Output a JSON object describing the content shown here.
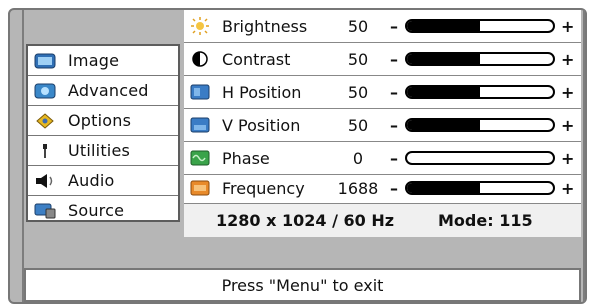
{
  "sidebar": {
    "items": [
      {
        "label": "Image",
        "icon": "image-icon",
        "selected": true
      },
      {
        "label": "Advanced",
        "icon": "advanced-icon"
      },
      {
        "label": "Options",
        "icon": "options-icon"
      },
      {
        "label": "Utilities",
        "icon": "utilities-icon"
      },
      {
        "label": "Audio",
        "icon": "audio-icon"
      },
      {
        "label": "Source",
        "icon": "source-icon"
      }
    ]
  },
  "settings": [
    {
      "label": "Brightness",
      "value": "50",
      "icon": "brightness-icon",
      "level": 0.5
    },
    {
      "label": "Contrast",
      "value": "50",
      "icon": "contrast-icon",
      "level": 0.5
    },
    {
      "label": "H Position",
      "value": "50",
      "icon": "h-position-icon",
      "level": 0.5
    },
    {
      "label": "V Position",
      "value": "50",
      "icon": "v-position-icon",
      "level": 0.5
    },
    {
      "label": "Phase",
      "value": "0",
      "icon": "phase-icon",
      "level": 0.0
    },
    {
      "label": "Frequency",
      "value": "1688",
      "icon": "frequency-icon",
      "level": 0.5
    }
  ],
  "controls": {
    "minus": "–",
    "plus": "+"
  },
  "status": {
    "resolution": "1280 x 1024 / 60 Hz",
    "mode": "Mode: 115"
  },
  "footer": {
    "hint": "Press \"Menu\" to exit"
  },
  "colors": {
    "frame": "#b6b6b6",
    "panel": "#ffffff",
    "bar_fill": "#000000"
  }
}
